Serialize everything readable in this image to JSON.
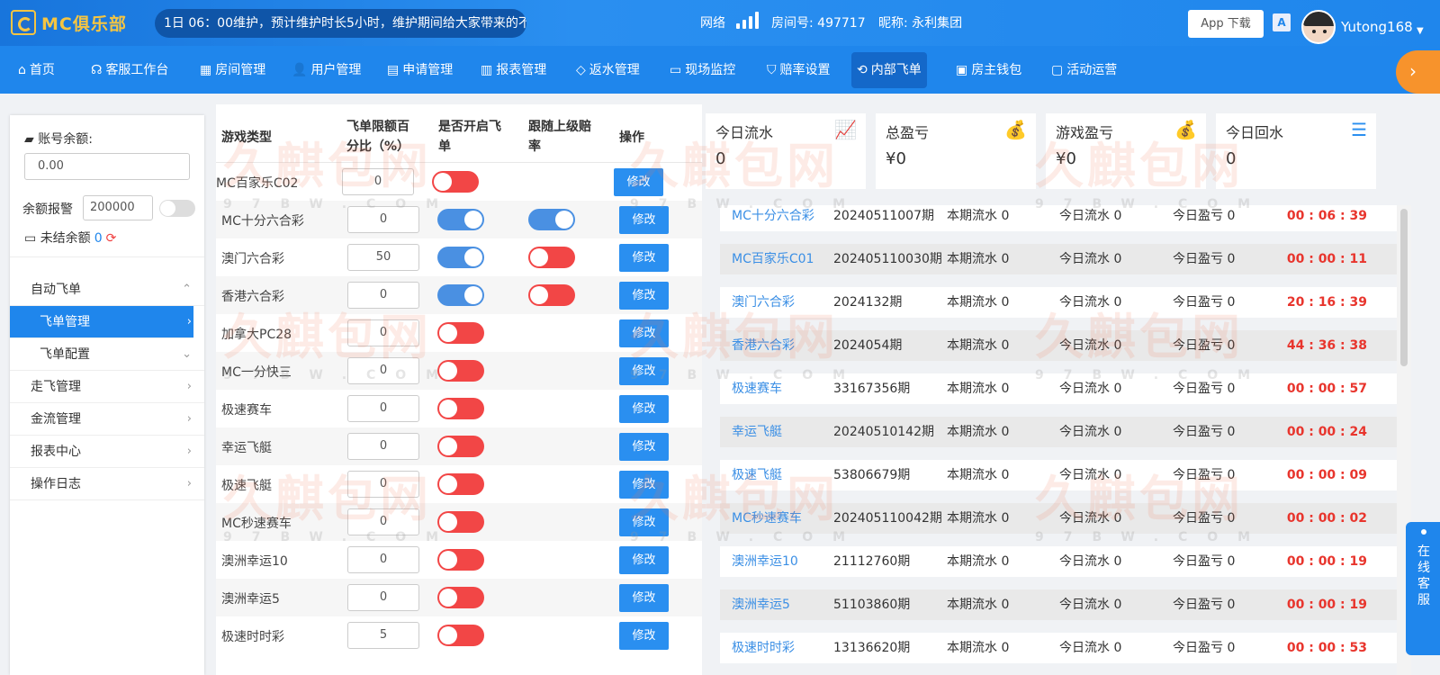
{
  "topbar": {
    "logo_text": "MC俱乐部",
    "marquee": "1日 06：00维护，预计维护时长5小时，维护期间给大家带来的不",
    "network_label": "网络",
    "room_label": "房间号: 497717",
    "nickname": "昵称: 永利集团",
    "app_download": "App 下载",
    "translate_icon_text": "A",
    "username": "Yutong168"
  },
  "nav": {
    "items": [
      {
        "label": "首页",
        "icon": "home-icon"
      },
      {
        "label": "客服工作台",
        "icon": "headset-icon"
      },
      {
        "label": "房间管理",
        "icon": "grid-icon"
      },
      {
        "label": "用户管理",
        "icon": "user-icon"
      },
      {
        "label": "申请管理",
        "icon": "document-icon"
      },
      {
        "label": "报表管理",
        "icon": "bar-chart-icon"
      },
      {
        "label": "返水管理",
        "icon": "tag-icon"
      },
      {
        "label": "现场监控",
        "icon": "monitor-icon"
      },
      {
        "label": "赔率设置",
        "icon": "shield-icon"
      },
      {
        "label": "内部飞单",
        "icon": "refresh-icon"
      },
      {
        "label": "房主钱包",
        "icon": "wallet-icon"
      },
      {
        "label": "活动运营",
        "icon": "ticket-icon"
      }
    ],
    "active": "内部飞单"
  },
  "left": {
    "balance_label": "账号余额:",
    "balance_value": "0.00",
    "alert_label": "余额报警",
    "alert_value": "200000",
    "unsettled_label": "未结余额",
    "unsettled_value": "0",
    "menu": [
      {
        "label": "自动飞单",
        "chev": "^",
        "level": 0,
        "active": false
      },
      {
        "label": "飞单管理",
        "chev": ">",
        "level": 1,
        "active": true
      },
      {
        "label": "飞单配置",
        "chev": "v",
        "level": 1,
        "active": false
      },
      {
        "label": "走飞管理",
        "chev": ">",
        "level": 0,
        "active": false
      },
      {
        "label": "金流管理",
        "chev": ">",
        "level": 0,
        "active": false
      },
      {
        "label": "报表中心",
        "chev": ">",
        "level": 0,
        "active": false
      },
      {
        "label": "操作日志",
        "chev": ">",
        "level": 0,
        "active": false
      }
    ]
  },
  "table": {
    "headers": {
      "game_type": "游戏类型",
      "limit_pct_1": "飞单限额百",
      "limit_pct_2": "分比（%）",
      "enable_1": "是否开启飞",
      "enable_2": "单",
      "follow_1": "跟随上级赔",
      "follow_2": "率",
      "action": "操作"
    },
    "edit_label": "修改",
    "rows": [
      {
        "name": "MC百家乐C02",
        "pct": "0",
        "enabled": false,
        "follow": null
      },
      {
        "name": "MC十分六合彩",
        "pct": "0",
        "enabled": true,
        "follow": true
      },
      {
        "name": "澳门六合彩",
        "pct": "50",
        "enabled": true,
        "follow": false
      },
      {
        "name": "香港六合彩",
        "pct": "0",
        "enabled": true,
        "follow": false
      },
      {
        "name": "加拿大PC28",
        "pct": "0",
        "enabled": false,
        "follow": null
      },
      {
        "name": "MC一分快三",
        "pct": "0",
        "enabled": false,
        "follow": null
      },
      {
        "name": "极速赛车",
        "pct": "0",
        "enabled": false,
        "follow": null
      },
      {
        "name": "幸运飞艇",
        "pct": "0",
        "enabled": false,
        "follow": null
      },
      {
        "name": "极速飞艇",
        "pct": "0",
        "enabled": false,
        "follow": null
      },
      {
        "name": "MC秒速赛车",
        "pct": "0",
        "enabled": false,
        "follow": null
      },
      {
        "name": "澳洲幸运10",
        "pct": "0",
        "enabled": false,
        "follow": null
      },
      {
        "name": "澳洲幸运5",
        "pct": "0",
        "enabled": false,
        "follow": null
      },
      {
        "name": "极速时时彩",
        "pct": "5",
        "enabled": false,
        "follow": null
      }
    ]
  },
  "stats": [
    {
      "title": "今日流水",
      "value": "0",
      "icon": "chart-icon",
      "glyph": "📈"
    },
    {
      "title": "总盈亏",
      "value": "¥0",
      "icon": "money-bag-icon",
      "glyph": "💰"
    },
    {
      "title": "游戏盈亏",
      "value": "¥0",
      "icon": "money-bag-icon",
      "glyph": "💰"
    },
    {
      "title": "今日回水",
      "value": "0",
      "icon": "sort-icon",
      "glyph": "☰"
    }
  ],
  "periods": [
    {
      "name": "MC十分六合彩",
      "period": "20240511007期",
      "c1": "本期流水 0",
      "c2": "今日流水 0",
      "c3": "今日盈亏 0",
      "time": "00 : 06 : 39"
    },
    {
      "name": "MC百家乐C01",
      "period": "202405110030期",
      "c1": "本期流水 0",
      "c2": "今日流水 0",
      "c3": "今日盈亏 0",
      "time": "00 : 00 : 11"
    },
    {
      "name": "澳门六合彩",
      "period": "2024132期",
      "c1": "本期流水 0",
      "c2": "今日流水 0",
      "c3": "今日盈亏 0",
      "time": "20 : 16 : 39"
    },
    {
      "name": "香港六合彩",
      "period": "2024054期",
      "c1": "本期流水 0",
      "c2": "今日流水 0",
      "c3": "今日盈亏 0",
      "time": "44 : 36 : 38"
    },
    {
      "name": "极速赛车",
      "period": "33167356期",
      "c1": "本期流水 0",
      "c2": "今日流水 0",
      "c3": "今日盈亏 0",
      "time": "00 : 00 : 57"
    },
    {
      "name": "幸运飞艇",
      "period": "20240510142期",
      "c1": "本期流水 0",
      "c2": "今日流水 0",
      "c3": "今日盈亏 0",
      "time": "00 : 00 : 24"
    },
    {
      "name": "极速飞艇",
      "period": "53806679期",
      "c1": "本期流水 0",
      "c2": "今日流水 0",
      "c3": "今日盈亏 0",
      "time": "00 : 00 : 09"
    },
    {
      "name": "MC秒速赛车",
      "period": "202405110042期",
      "c1": "本期流水 0",
      "c2": "今日流水 0",
      "c3": "今日盈亏 0",
      "time": "00 : 00 : 02"
    },
    {
      "name": "澳洲幸运10",
      "period": "21112760期",
      "c1": "本期流水 0",
      "c2": "今日流水 0",
      "c3": "今日盈亏 0",
      "time": "00 : 00 : 19"
    },
    {
      "name": "澳洲幸运5",
      "period": "51103860期",
      "c1": "本期流水 0",
      "c2": "今日流水 0",
      "c3": "今日盈亏 0",
      "time": "00 : 00 : 19"
    },
    {
      "name": "极速时时彩",
      "period": "13136620期",
      "c1": "本期流水 0",
      "c2": "今日流水 0",
      "c3": "今日盈亏 0",
      "time": "00 : 00 : 53"
    }
  ],
  "service_label": "在线客服",
  "watermark": {
    "text": "久麒包网",
    "sub": "97BW.COM"
  },
  "colors": {
    "primary": "#1f86ec",
    "danger": "#f24646",
    "switch_on": "#4a90e2",
    "countdown": "#e8352d",
    "accent": "#f7932c"
  }
}
